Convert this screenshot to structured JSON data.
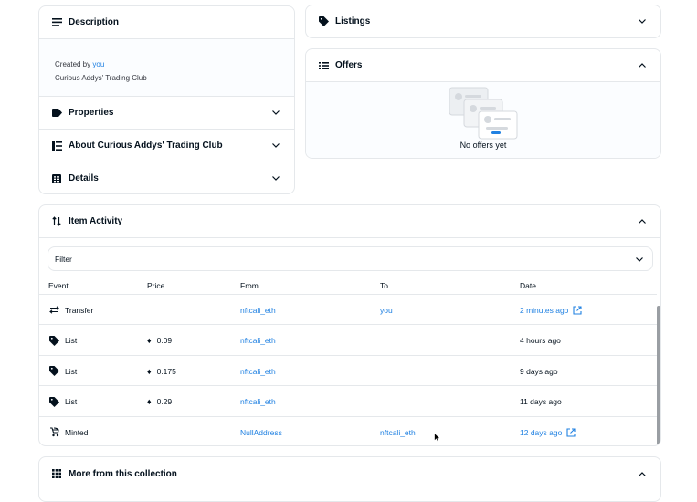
{
  "description": {
    "title": "Description",
    "created_by_label": "Created by",
    "created_by_user": "you",
    "collection_name": "Curious Addys' Trading Club"
  },
  "sections": {
    "properties": "Properties",
    "about": "About Curious Addys' Trading Club",
    "details": "Details"
  },
  "listings": {
    "title": "Listings"
  },
  "offers": {
    "title": "Offers",
    "empty_text": "No offers yet"
  },
  "item_activity": {
    "title": "Item Activity",
    "filter_label": "Filter",
    "columns": [
      "Event",
      "Price",
      "From",
      "To",
      "Date"
    ],
    "rows": [
      {
        "event": "Transfer",
        "icon": "transfer-icon",
        "price": "",
        "from": "nftcali_eth",
        "to": "you",
        "date": "2 minutes ago",
        "date_link": true
      },
      {
        "event": "List",
        "icon": "tag-icon",
        "price": "0.09",
        "from": "nftcali_eth",
        "to": "",
        "date": "4 hours ago",
        "date_link": false
      },
      {
        "event": "List",
        "icon": "tag-icon",
        "price": "0.175",
        "from": "nftcali_eth",
        "to": "",
        "date": "9 days ago",
        "date_link": false
      },
      {
        "event": "List",
        "icon": "tag-icon",
        "price": "0.29",
        "from": "nftcali_eth",
        "to": "",
        "date": "11 days ago",
        "date_link": false
      },
      {
        "event": "Minted",
        "icon": "stroller-icon",
        "price": "",
        "from": "NullAddress",
        "to": "nftcali_eth",
        "date": "12 days ago",
        "date_link": true
      }
    ]
  },
  "more": {
    "title": "More from this collection"
  },
  "colors": {
    "link": "#2081e2",
    "border": "#e5e8eb",
    "text": "#04111d"
  }
}
